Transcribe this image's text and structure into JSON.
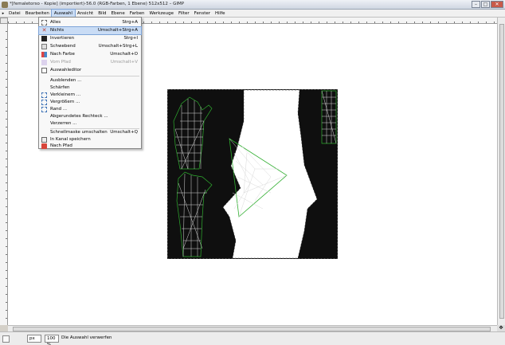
{
  "window": {
    "title": "*[femaletorso - Kopie] (importiert)-56.0 (RGB-Farben, 1 Ebene) 512x512 – GIMP",
    "buttons": {
      "minimize": "–",
      "maximize": "□",
      "close": "✕"
    }
  },
  "menubar": {
    "arrow": "▸",
    "items": [
      "Datei",
      "Bearbeiten",
      "Auswahl",
      "Ansicht",
      "Bild",
      "Ebene",
      "Farben",
      "Werkzeuge",
      "Filter",
      "Fenster",
      "Hilfe"
    ],
    "active_index": 2
  },
  "select_menu": {
    "items": [
      {
        "label": "Alles",
        "shortcut": "Strg+A",
        "icon": "select-all-icon"
      },
      {
        "label": "Nichts",
        "shortcut": "Umschalt+Strg+A",
        "icon": "select-none-icon"
      },
      {
        "label": "Invertieren",
        "shortcut": "Strg+I",
        "icon": "invert-icon"
      },
      {
        "label": "Schwebend",
        "shortcut": "Umschalt+Strg+L",
        "icon": "float-icon"
      },
      {
        "label": "Nach Farbe",
        "shortcut": "Umschalt+O",
        "icon": "by-color-icon"
      },
      {
        "label": "Vom Pfad",
        "shortcut": "Umschalt+V",
        "icon": "from-path-icon"
      },
      {
        "label": "Auswahleditor",
        "shortcut": "",
        "icon": "selection-editor-icon"
      },
      {
        "label": "Ausblenden ...",
        "shortcut": "",
        "icon": ""
      },
      {
        "label": "Schärfen",
        "shortcut": "",
        "icon": ""
      },
      {
        "label": "Verkleinern ...",
        "shortcut": "",
        "icon": "shrink-icon"
      },
      {
        "label": "Vergrößern ...",
        "shortcut": "",
        "icon": "grow-icon"
      },
      {
        "label": "Rand ...",
        "shortcut": "",
        "icon": "border-icon"
      },
      {
        "label": "Abgerundetes Rechteck ...",
        "shortcut": "",
        "icon": ""
      },
      {
        "label": "Verzerren ...",
        "shortcut": "",
        "icon": ""
      },
      {
        "label": "Schnellmaske umschalten",
        "shortcut": "Umschalt+Q",
        "icon": ""
      },
      {
        "label": "In Kanal speichern",
        "shortcut": "",
        "icon": "save-channel-icon"
      },
      {
        "label": "Nach Pfad",
        "shortcut": "",
        "icon": "to-path-icon"
      }
    ],
    "highlighted_index": 1,
    "disabled_index": 5
  },
  "statusbar": {
    "unit": "px",
    "zoom": "100 %",
    "message": "Die Auswahl verwerfen"
  },
  "colors": {
    "menu_highlight": "#c9dcf5",
    "canvas_bg": "#ffffff",
    "image_bg": "#0f0f0f",
    "mesh_line": "#d8d8d8",
    "selection_green": "#2fae2f"
  }
}
